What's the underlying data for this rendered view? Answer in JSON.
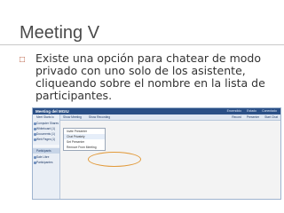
{
  "slide": {
    "title": "Meeting V",
    "bullet_text": "Existe una opción para chatear de modo privado con uno solo de los asistente, cliqueando sobre el nombre en la lista de participantes."
  },
  "screenshot": {
    "window_title": "Meeting del MGIU",
    "top_links": [
      "Encendido",
      "Estado",
      "Conectado"
    ],
    "toolbar_left": [
      "Show Meeting",
      "Show Recording"
    ],
    "toolbar_right": [
      "Record",
      "Presenter",
      "Start Chat"
    ],
    "sidebar": [
      {
        "label": "Meet Starts to",
        "header": false
      },
      {
        "label": "Computer Shares",
        "header": false
      },
      {
        "label": "Whiteboard (1)",
        "header": false
      },
      {
        "label": "Documents (1)",
        "header": false
      },
      {
        "label": "Web Pages (1)",
        "header": false
      },
      {
        "label": "Participants",
        "header": true
      },
      {
        "label": "Sale Libre",
        "header": false
      },
      {
        "label": "Participantes",
        "header": false
      }
    ],
    "context_menu": [
      {
        "label": "Invite Presenter",
        "highlight": false
      },
      {
        "label": "Chat Privately",
        "highlight": true
      },
      {
        "label": "Set Presenter",
        "highlight": false
      },
      {
        "label": "Remove From Meeting",
        "highlight": false
      }
    ]
  },
  "colors": {
    "bullet": "#b04a2a",
    "highlight_oval": "#e29a3a"
  }
}
